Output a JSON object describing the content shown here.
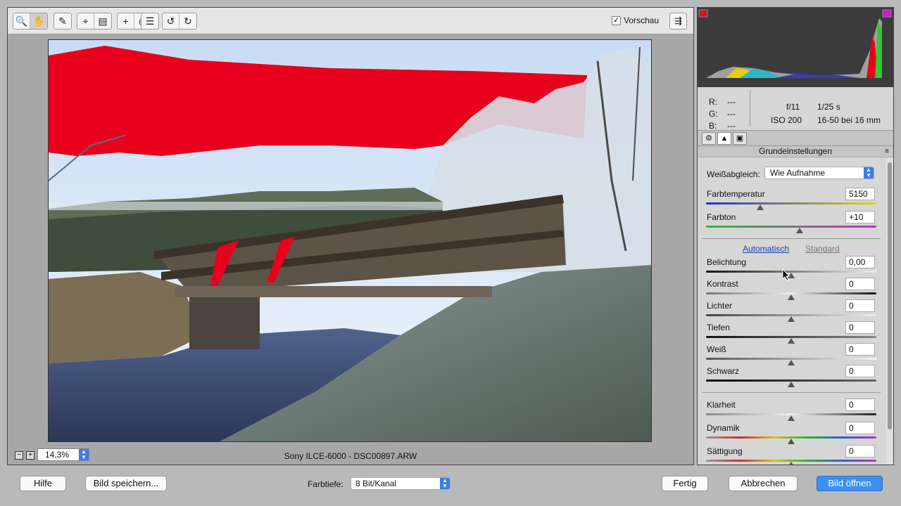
{
  "toolbar": {
    "tools": [
      "zoom-tool",
      "hand-tool",
      "white-balance-tool",
      "crop-tool",
      "straighten-tool",
      "spot-removal-tool",
      "red-eye-tool",
      "preferences",
      "rotate-left",
      "rotate-right"
    ],
    "preview_label": "Vorschau",
    "preview_checked": true
  },
  "status": {
    "zoom_value": "14,3%",
    "filename": "Sony ILCE-6000 - DSC00897.ARW"
  },
  "info": {
    "r_label": "R:",
    "r_value": "---",
    "g_label": "G:",
    "g_value": "---",
    "b_label": "B:",
    "b_value": "---",
    "aperture": "f/11",
    "shutter": "1/25 s",
    "iso": "ISO 200",
    "lens": "16-50 bei 16 mm"
  },
  "panel": {
    "title": "Grundeinstellungen",
    "wb_label": "Weißabgleich:",
    "wb_value": "Wie Aufnahme",
    "auto_label": "Automatisch",
    "default_label": "Standard",
    "sliders": [
      {
        "label": "Farbtemperatur",
        "value": "5150",
        "pos": 0.32
      },
      {
        "label": "Farbton",
        "value": "+10",
        "pos": 0.55
      },
      {
        "label": "Belichtung",
        "value": "0,00",
        "pos": 0.5
      },
      {
        "label": "Kontrast",
        "value": "0",
        "pos": 0.5
      },
      {
        "label": "Lichter",
        "value": "0",
        "pos": 0.5
      },
      {
        "label": "Tiefen",
        "value": "0",
        "pos": 0.5
      },
      {
        "label": "Weiß",
        "value": "0",
        "pos": 0.5
      },
      {
        "label": "Schwarz",
        "value": "0",
        "pos": 0.5
      },
      {
        "label": "Klarheit",
        "value": "0",
        "pos": 0.5
      },
      {
        "label": "Dynamik",
        "value": "0",
        "pos": 0.5
      },
      {
        "label": "Sättigung",
        "value": "0",
        "pos": 0.5
      }
    ]
  },
  "bottom": {
    "help": "Hilfe",
    "save": "Bild speichern...",
    "depth_label": "Farbtiefe:",
    "depth_value": "8 Bit/Kanal",
    "done": "Fertig",
    "cancel": "Abbrechen",
    "open": "Bild öffnen"
  },
  "colors": {
    "accent": "#3d8ef0",
    "clipping": "#e8001c"
  }
}
